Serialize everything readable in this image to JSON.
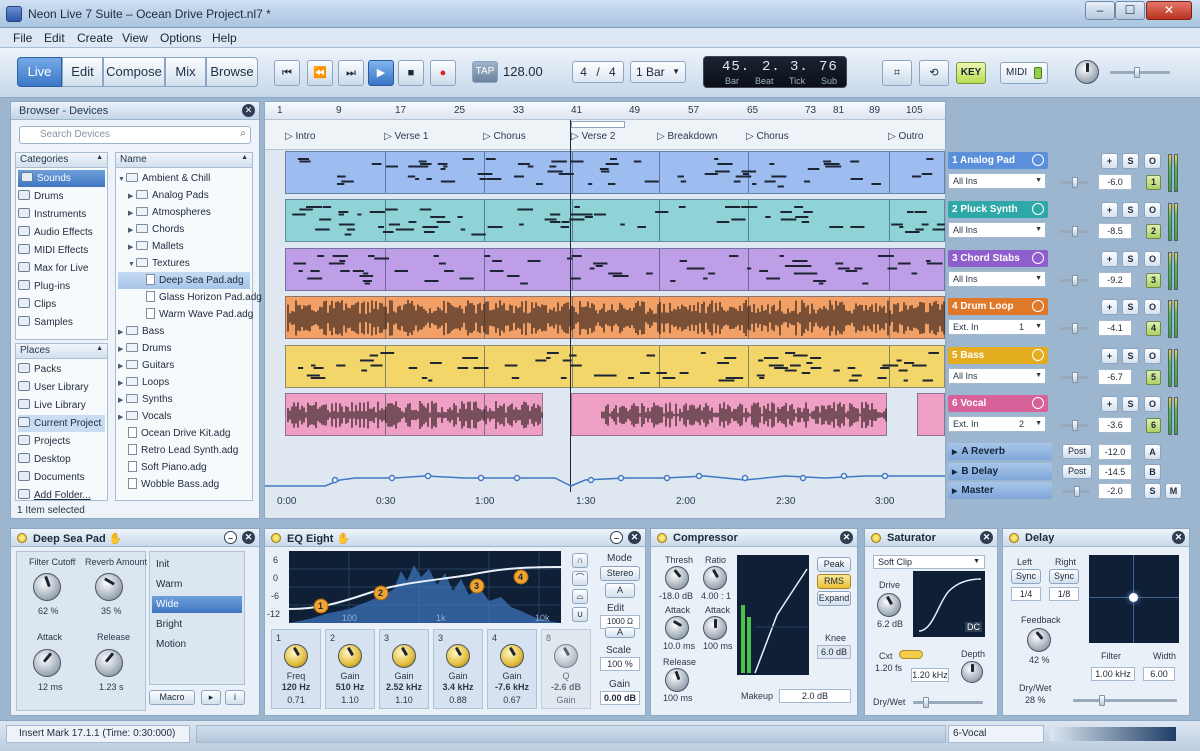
{
  "window": {
    "title": "Neon Live 7 Suite – Ocean Drive Project.nl7 *",
    "min": "–",
    "max": "☐",
    "close": "✕"
  },
  "menu": [
    "File",
    "Edit",
    "Create",
    "View",
    "Options",
    "Help"
  ],
  "modes": [
    "Live",
    "Edit",
    "Compose",
    "Mix",
    "Browse"
  ],
  "transport": {
    "tap": "TAP",
    "tempo": "128.00",
    "signature_num": "4",
    "signature_sep": "/",
    "signature_den": "4",
    "quantize": "1 Bar",
    "rewind_start": "⏮",
    "rewind": "⏪",
    "forward": "⏭",
    "play": "▶",
    "stop": "■",
    "record": "●"
  },
  "position": {
    "bar": "45.",
    "beat": "2.",
    "tick": "3.",
    "sub": "76",
    "bar_l": "Bar",
    "beat_l": "Beat",
    "tick_l": "Tick",
    "sub_l": "Sub"
  },
  "right_tools": {
    "key": "KEY",
    "midi": "MIDI"
  },
  "browser": {
    "title": "Browser - Devices",
    "search_placeholder": "Search Devices",
    "categories_h": "Categories",
    "categories": [
      "Sounds",
      "Drums",
      "Instruments",
      "Audio Effects",
      "MIDI Effects",
      "Max for Live",
      "Plug-ins",
      "Clips",
      "Samples"
    ],
    "places_h": "Places",
    "places": [
      "Packs",
      "User Library",
      "Live Library",
      "Current Project",
      "Projects",
      "Desktop",
      "Documents",
      "Add Folder..."
    ],
    "name_h": "Name",
    "tree": [
      "Ambient & Chill",
      "Analog Pads",
      "Atmospheres",
      "Chords",
      "Mallets",
      "Textures",
      "Deep Sea Pad.adg",
      "Glass Horizon Pad.adg",
      "Warm Wave Pad.adg",
      "Bass",
      "Drums",
      "Guitars",
      "Loops",
      "Synths",
      "Vocals",
      "Ocean Drive Kit.adg",
      "Retro Lead Synth.adg",
      "Soft Piano.adg",
      "Wobble Bass.adg"
    ],
    "status": "1 Item selected"
  },
  "arrangement": {
    "ruler": [
      "1",
      "9",
      "17",
      "25",
      "33",
      "41",
      "49",
      "57",
      "65",
      "73",
      "81",
      "89",
      "105"
    ],
    "markers": [
      "Intro",
      "Verse 1",
      "Chorus",
      "Verse 2",
      "Breakdown",
      "Chorus",
      "Outro"
    ],
    "times": [
      "0:00",
      "0:30",
      "1:00",
      "1:30",
      "2:00",
      "2:30",
      "3:00"
    ]
  },
  "tracks": [
    {
      "name": "1 Analog Pad",
      "input": "All Ins",
      "vol": "-6.0",
      "num": "1",
      "color": "#5a8fdc",
      "clip": "#9dbdf0"
    },
    {
      "name": "2 Pluck Synth",
      "input": "All Ins",
      "vol": "-8.5",
      "num": "2",
      "color": "#2fa8a8",
      "clip": "#8fd3d6"
    },
    {
      "name": "3 Chord Stabs",
      "input": "All Ins",
      "vol": "-9.2",
      "num": "3",
      "color": "#8e5fcc",
      "clip": "#bf9ee8"
    },
    {
      "name": "4 Drum Loop",
      "input": "Ext. In",
      "inch": "1",
      "vol": "-4.1",
      "num": "4",
      "color": "#e0782a",
      "clip": "#f2a066"
    },
    {
      "name": "5 Bass",
      "input": "All Ins",
      "vol": "-6.7",
      "num": "5",
      "color": "#e3ad1f",
      "clip": "#f3d66a"
    },
    {
      "name": "6 Vocal",
      "input": "Ext. In",
      "inch": "2",
      "vol": "-3.6",
      "num": "6",
      "color": "#d9619a",
      "clip": "#ef9fc4"
    }
  ],
  "returns": [
    {
      "name": "A Reverb",
      "post": "Post",
      "vol": "-12.0",
      "letter": "A"
    },
    {
      "name": "B Delay",
      "post": "Post",
      "vol": "-14.5",
      "letter": "B"
    },
    {
      "name": "Master",
      "vol": "-2.0",
      "letter": "S",
      "letter2": "M"
    }
  ],
  "mixer_btn": {
    "plus": "+",
    "solo": "S",
    "off": "O"
  },
  "rack": {
    "title": "Deep Sea Pad",
    "k1": "Filter Cutoff",
    "v1": "62 %",
    "k2": "Reverb Amount",
    "v2": "35 %",
    "k3": "Attack",
    "v3": "12 ms",
    "k4": "Release",
    "v4": "1.23 s",
    "presets": [
      "Init",
      "Warm",
      "Wide",
      "Bright",
      "Motion"
    ],
    "macro": "Macro"
  },
  "eq": {
    "title": "EQ Eight",
    "mode_l": "Mode",
    "mode": "Stereo",
    "a": "A",
    "edit_l": "Edit",
    "edit": "1000 Ω",
    "scale_l": "Scale",
    "scale": "100 %",
    "gain_l": "Gain",
    "gain": "0.00 dB",
    "band_nums": [
      "1",
      "2",
      "3",
      "4",
      "5",
      "6"
    ],
    "freq_axis": [
      "10",
      "100",
      "1k",
      "10k"
    ],
    "db_axis": [
      "6",
      "0",
      "-6",
      "-12"
    ],
    "bands": [
      {
        "n": "1",
        "p": "Freq",
        "v": "120 Hz",
        "q": "0.71"
      },
      {
        "n": "2",
        "p": "Gain",
        "v": "510 Hz",
        "q": "1.10"
      },
      {
        "n": "3",
        "p": "Gain",
        "v": "2.52 kHz",
        "q": "1.10"
      },
      {
        "n": "3",
        "p": "Gain",
        "v": "3.4 kHz",
        "q": "0.88"
      },
      {
        "n": "4",
        "p": "Gain",
        "v": "-7.6 kHz",
        "q": "0.67"
      },
      {
        "n": "8",
        "p": "Q",
        "v": "-2.6 dB",
        "q": "Gain"
      }
    ]
  },
  "comp": {
    "title": "Compressor",
    "thresh": "Thresh",
    "thresh_v": "-18.0 dB",
    "ratio": "Ratio",
    "ratio_v": "4.00 : 1",
    "attack": "Attack",
    "attack_v": "10.0 ms",
    "attack2": "Attack",
    "attack2_v": "100 ms",
    "release": "Release",
    "release_v": "100 ms",
    "peak": "Peak",
    "rms": "RMS",
    "expand": "Expand",
    "knee": "Knee",
    "knee_v": "6.0 dB",
    "makeup": "Makeup",
    "makeup_v": "2.0 dB"
  },
  "sat": {
    "title": "Saturator",
    "type": "Soft Clip",
    "drive": "Drive",
    "drive_v": "6.2 dB",
    "dc": "DC",
    "cxt": "Cxt",
    "cxt_v": "1.20 fs",
    "freq_v": "1.20 kHz",
    "depth": "Depth",
    "drywet": "Dry/Wet"
  },
  "delay": {
    "title": "Delay",
    "left": "Left",
    "right": "Right",
    "sync": "Sync",
    "l_v": "1/4",
    "r_v": "1/8",
    "feedback": "Feedback",
    "feedback_v": "42 %",
    "drywet": "Dry/Wet",
    "drywet_v": "28 %",
    "filter": "Filter",
    "filter_v": "1.00 kHz",
    "width": "Width",
    "width_v": "6.00"
  },
  "status": {
    "left": "Insert Mark 17.1.1 (Time: 0:30:000)",
    "right": "6-Vocal"
  },
  "colors": {
    "accent": "#3c78c8",
    "lcd": "#0b0f17"
  }
}
